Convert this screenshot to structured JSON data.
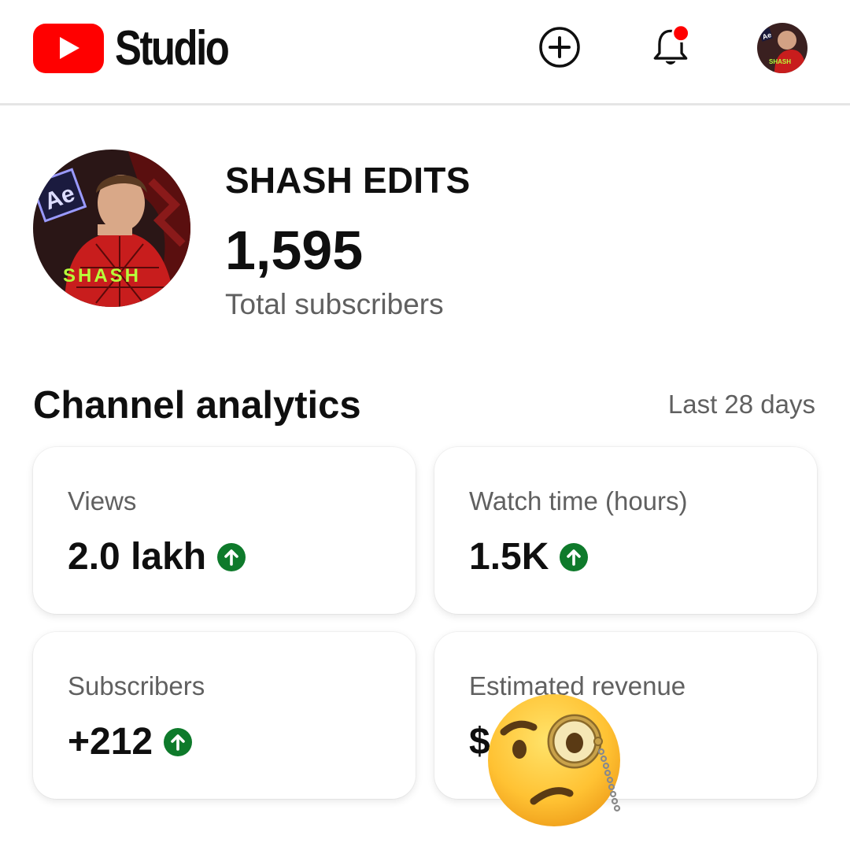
{
  "header": {
    "logo_text": "Studio",
    "icons": [
      "youtube-logo-icon",
      "create-plus-icon",
      "notification-bell-icon",
      "account-avatar"
    ],
    "notification_dot_color": "#ff0000"
  },
  "channel": {
    "name": "SHASH EDITS",
    "subscriber_count": "1,595",
    "subscriber_label": "Total subscribers",
    "avatar_texts": [
      "Ae",
      "SHASH"
    ]
  },
  "analytics": {
    "title": "Channel analytics",
    "period": "Last 28 days",
    "cards": [
      {
        "label": "Views",
        "value": "2.0 lakh",
        "trend": "up"
      },
      {
        "label": "Watch time (hours)",
        "value": "1.5K",
        "trend": "up"
      },
      {
        "label": "Subscribers",
        "value": "+212",
        "trend": "up"
      },
      {
        "label": "Estimated revenue",
        "value": "$"
      }
    ],
    "trend_color": "#0e7a2b"
  },
  "overlay": {
    "emoji": "face-with-monocle-emoji"
  }
}
